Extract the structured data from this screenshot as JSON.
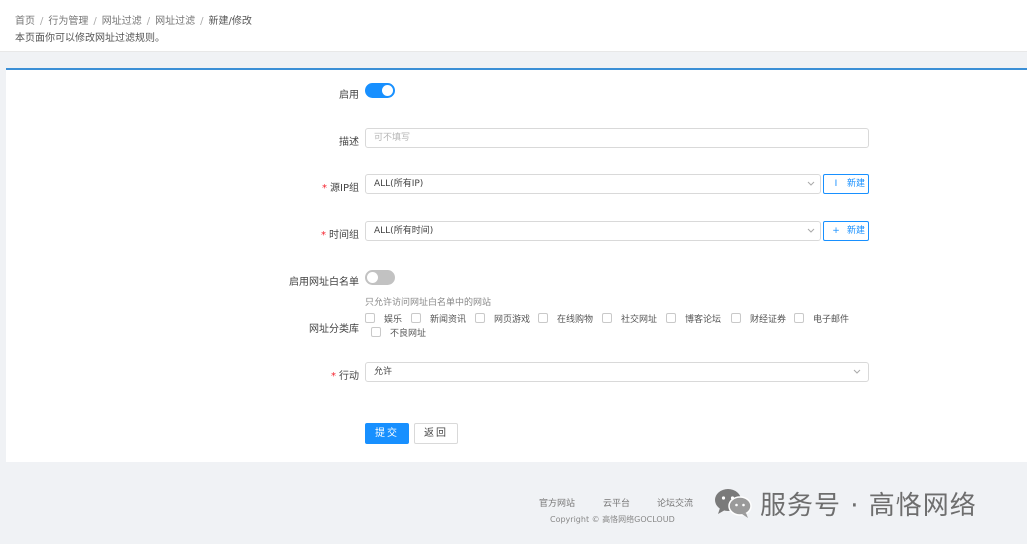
{
  "breadcrumb": {
    "items": [
      "首页",
      "行为管理",
      "网址过滤",
      "网址过滤"
    ],
    "current": "新建/修改",
    "separator": "/"
  },
  "page_description": "本页面你可以修改网址过滤规则。",
  "form": {
    "enable": {
      "label": "启用",
      "value": true
    },
    "description": {
      "label": "描述",
      "value": "",
      "placeholder": "可不填写"
    },
    "source_ip_group": {
      "label": "源IP组",
      "required_mark": "*",
      "value": "ALL(所有IP)",
      "new_button": "新建"
    },
    "time_group": {
      "label": "时间组",
      "required_mark": "*",
      "value": "ALL(所有时间)",
      "new_button": "新建"
    },
    "whitelist": {
      "label": "启用网址白名单",
      "value": false,
      "hint": "只允许访问网址白名单中的网站"
    },
    "categories": {
      "label": "网址分类库",
      "options": [
        {
          "label": "娱乐",
          "checked": false
        },
        {
          "label": "新闻资讯",
          "checked": false
        },
        {
          "label": "网页游戏",
          "checked": false
        },
        {
          "label": "在线购物",
          "checked": false
        },
        {
          "label": "社交网址",
          "checked": false
        },
        {
          "label": "博客论坛",
          "checked": false
        },
        {
          "label": "财经证券",
          "checked": false
        },
        {
          "label": "电子邮件",
          "checked": false
        },
        {
          "label": "不良网址",
          "checked": false
        }
      ]
    },
    "action": {
      "label": "行动",
      "required_mark": "*",
      "value": "允许"
    },
    "submit_label": "提交",
    "back_label": "返回"
  },
  "footer": {
    "links": [
      "官方网站",
      "云平台",
      "论坛交流"
    ],
    "copyright": "Copyright © 高恪网络GOCLOUD"
  },
  "watermark": {
    "text": "服务号 · 高恪网络"
  },
  "colors": {
    "primary": "#1890ff",
    "card_top_border": "#3b8fd6",
    "required": "#f5222d",
    "page_background": "#f0f2f5"
  }
}
